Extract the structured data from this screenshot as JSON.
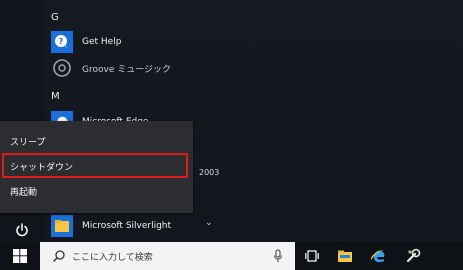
{
  "start_menu": {
    "sections": [
      {
        "letter": "G"
      },
      {
        "letter": "M"
      }
    ],
    "apps": [
      {
        "label": "Get Help",
        "icon": "help-icon"
      },
      {
        "label": "Groove ミュージック",
        "icon": "groove-music-icon"
      },
      {
        "label": "Microsoft Edge",
        "icon": "edge-icon"
      },
      {
        "label": "Microsoft Silverlight",
        "icon": "folder-icon"
      }
    ],
    "partial_text": "2003"
  },
  "power_menu": {
    "items": [
      "スリープ",
      "シャットダウン",
      "再起動"
    ],
    "highlighted": "シャットダウン"
  },
  "taskbar": {
    "search_placeholder": "ここに入力して検索",
    "icons": [
      "windows-logo-icon",
      "microphone-icon",
      "task-view-icon",
      "file-explorer-icon",
      "internet-explorer-icon",
      "tool-icon"
    ]
  },
  "colors": {
    "tile_blue": "#1b6fd8",
    "highlight_red": "#e01919",
    "folder_yellow": "#f6c744"
  }
}
